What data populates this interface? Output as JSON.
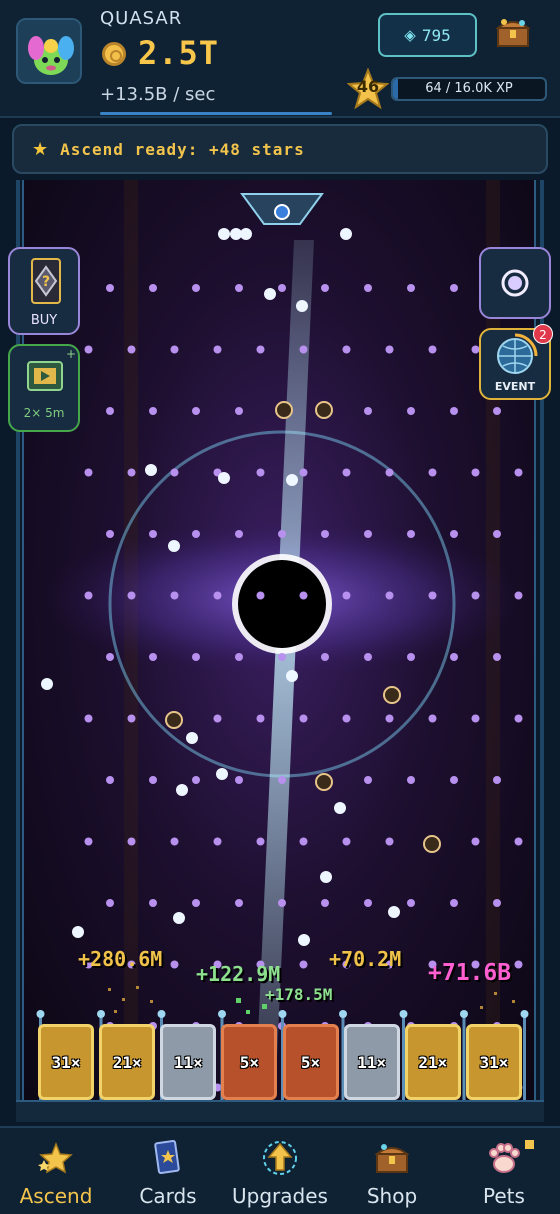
{
  "header": {
    "player_name": "QUASAR",
    "coin_total": "2.5T",
    "rate": "+13.5B / sec",
    "gems": "795",
    "level": "46",
    "xp_text": "64 / 16.0K XP",
    "xp_progress": 0.004
  },
  "banner": {
    "text": "Ascend ready: +48 stars"
  },
  "side_buttons": {
    "buy_label": "BUY",
    "boost_label": "2× 5m",
    "event_label": "EVENT",
    "event_badge": "2"
  },
  "floating_rewards": [
    "+280.6M",
    "+122.9M",
    "+70.2M",
    "+71.6B",
    "+178.5M"
  ],
  "buckets": [
    {
      "label": "31×",
      "tier": "gold"
    },
    {
      "label": "21×",
      "tier": "gold"
    },
    {
      "label": "11×",
      "tier": "silver"
    },
    {
      "label": "5×",
      "tier": "copper"
    },
    {
      "label": "5×",
      "tier": "copper"
    },
    {
      "label": "11×",
      "tier": "silver"
    },
    {
      "label": "21×",
      "tier": "gold"
    },
    {
      "label": "31×",
      "tier": "gold"
    }
  ],
  "nav": {
    "items": [
      {
        "label": "Ascend",
        "icon": "star-cluster-icon"
      },
      {
        "label": "Cards",
        "icon": "cards-icon"
      },
      {
        "label": "Upgrades",
        "icon": "upgrade-arrow-icon"
      },
      {
        "label": "Shop",
        "icon": "treasure-chest-icon"
      },
      {
        "label": "Pets",
        "icon": "paw-icon"
      }
    ]
  },
  "colors": {
    "coin": "#f7c64a",
    "gem": "#8fe7f1",
    "bonus_pink": "#ff5fd0",
    "bonus_green": "#8de08d",
    "peg": "#b890ee"
  }
}
